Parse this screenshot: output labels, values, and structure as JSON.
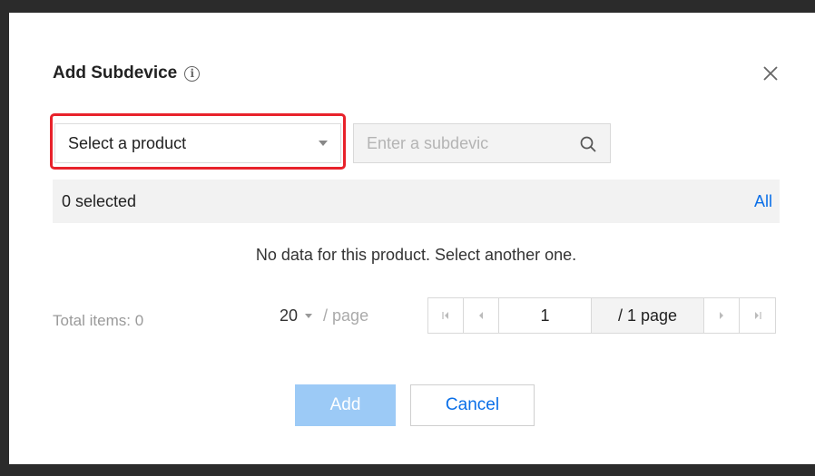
{
  "dialog": {
    "title": "Add Subdevice",
    "info_icon_glyph": "i"
  },
  "filters": {
    "product_select": "Select a product",
    "search_placeholder": "Enter a subdevic"
  },
  "selection": {
    "count_text": "0 selected",
    "all_label": "All"
  },
  "empty_message": "No data for this product. Select another one.",
  "pagination": {
    "total_label": "Total items: 0",
    "per_page_value": "20",
    "per_page_unit": "/ page",
    "current_page": "1",
    "total_pages_label": "/ 1 page"
  },
  "actions": {
    "add_label": "Add",
    "cancel_label": "Cancel"
  },
  "colors": {
    "highlight": "#e8222b",
    "primary_disabled": "#9ccaf6",
    "link": "#0a6fe8"
  }
}
